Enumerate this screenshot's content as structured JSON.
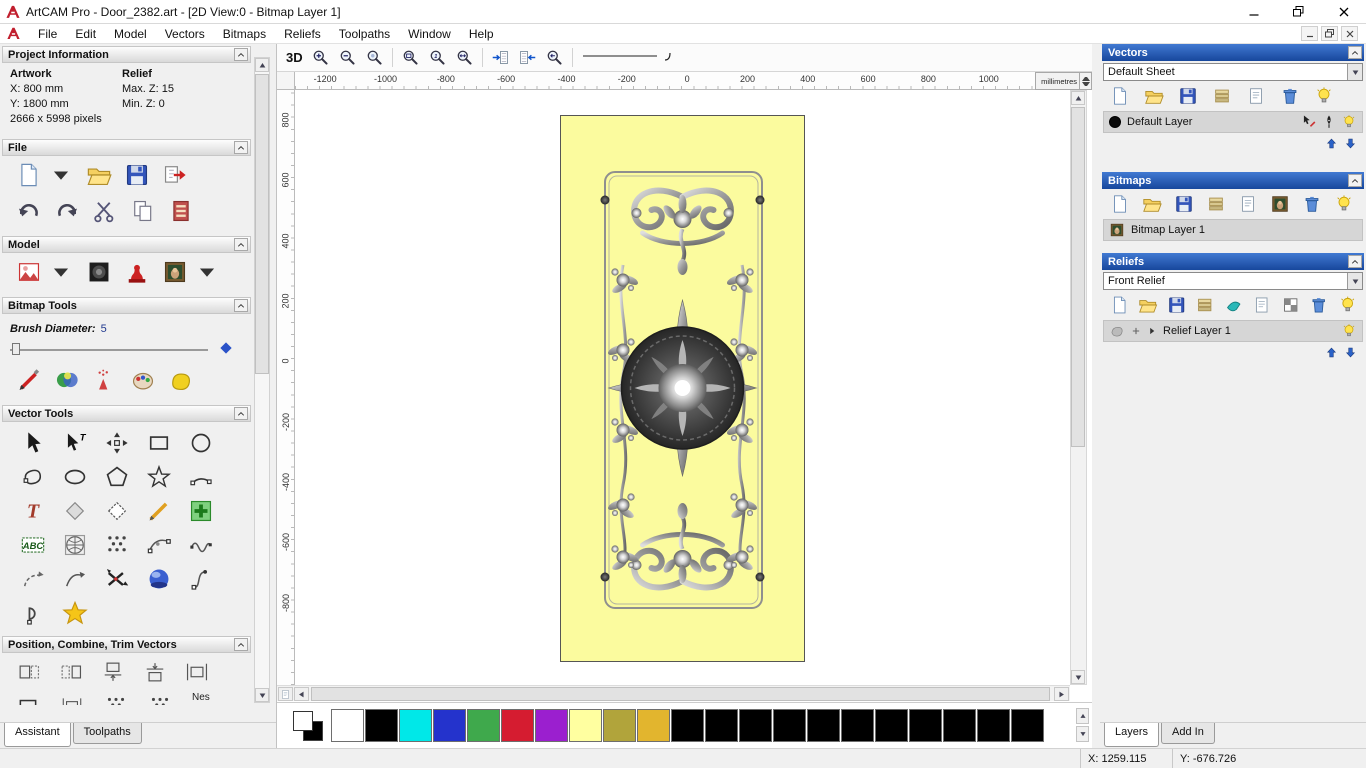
{
  "window": {
    "title": "ArtCAM Pro - Door_2382.art - [2D View:0 - Bitmap Layer 1]"
  },
  "menu": {
    "items": [
      "File",
      "Edit",
      "Model",
      "Vectors",
      "Bitmaps",
      "Reliefs",
      "Toolpaths",
      "Window",
      "Help"
    ]
  },
  "assistant": {
    "project_information": {
      "title": "Project Information",
      "columns": {
        "artwork": "Artwork",
        "relief": "Relief"
      },
      "artwork": {
        "x": "X: 800 mm",
        "y": "Y: 1800 mm",
        "pixels": "2666 x 5998 pixels"
      },
      "relief": {
        "max_z": "Max. Z: 15",
        "min_z": "Min. Z: 0"
      }
    },
    "file_section": {
      "title": "File"
    },
    "model_section": {
      "title": "Model"
    },
    "bitmap_tools": {
      "title": "Bitmap Tools",
      "brush_diameter_label": "Brush Diameter:",
      "brush_diameter_value": "5"
    },
    "vector_tools": {
      "title": "Vector Tools"
    },
    "position_section": {
      "title": "Position, Combine, Trim Vectors",
      "clipped_label": "Nes"
    },
    "tabs": [
      {
        "label": "Assistant",
        "active": true
      },
      {
        "label": "Toolpaths",
        "active": false
      }
    ]
  },
  "view": {
    "toolbar": {
      "view_3d_label": "3D"
    },
    "ruler": {
      "h_labels": [
        "-1200",
        "-1000",
        "-800",
        "-600",
        "-400",
        "-200",
        "0",
        "200",
        "400",
        "600",
        "800",
        "1000"
      ],
      "v_labels": [
        "800",
        "600",
        "400",
        "200",
        "0",
        "-200",
        "-400",
        "-600",
        "-800"
      ],
      "units": "millimetres"
    },
    "palette": {
      "colors": [
        "#ffffff",
        "#000000",
        "#00e8e8",
        "#2433cc",
        "#3fa94c",
        "#d51c30",
        "#9b1fcf",
        "#ffffa0",
        "#b1a43b",
        "#e2b52e",
        "#000000",
        "#000000",
        "#000000",
        "#000000",
        "#000000",
        "#000000",
        "#000000",
        "#000000",
        "#000000",
        "#000000",
        "#000000"
      ]
    }
  },
  "layers_panel": {
    "vectors": {
      "title": "Vectors",
      "sheet_selector_value": "Default Sheet",
      "layer_name": "Default Layer"
    },
    "bitmaps": {
      "title": "Bitmaps",
      "layer_name": "Bitmap Layer 1"
    },
    "reliefs": {
      "title": "Reliefs",
      "relief_selector_value": "Front Relief",
      "layer_name": "Relief Layer 1"
    },
    "tabs": [
      {
        "label": "Layers",
        "active": true
      },
      {
        "label": "Add In",
        "active": false
      }
    ]
  },
  "status_bar": {
    "x": "X: 1259.115",
    "y": "Y: -676.726"
  }
}
